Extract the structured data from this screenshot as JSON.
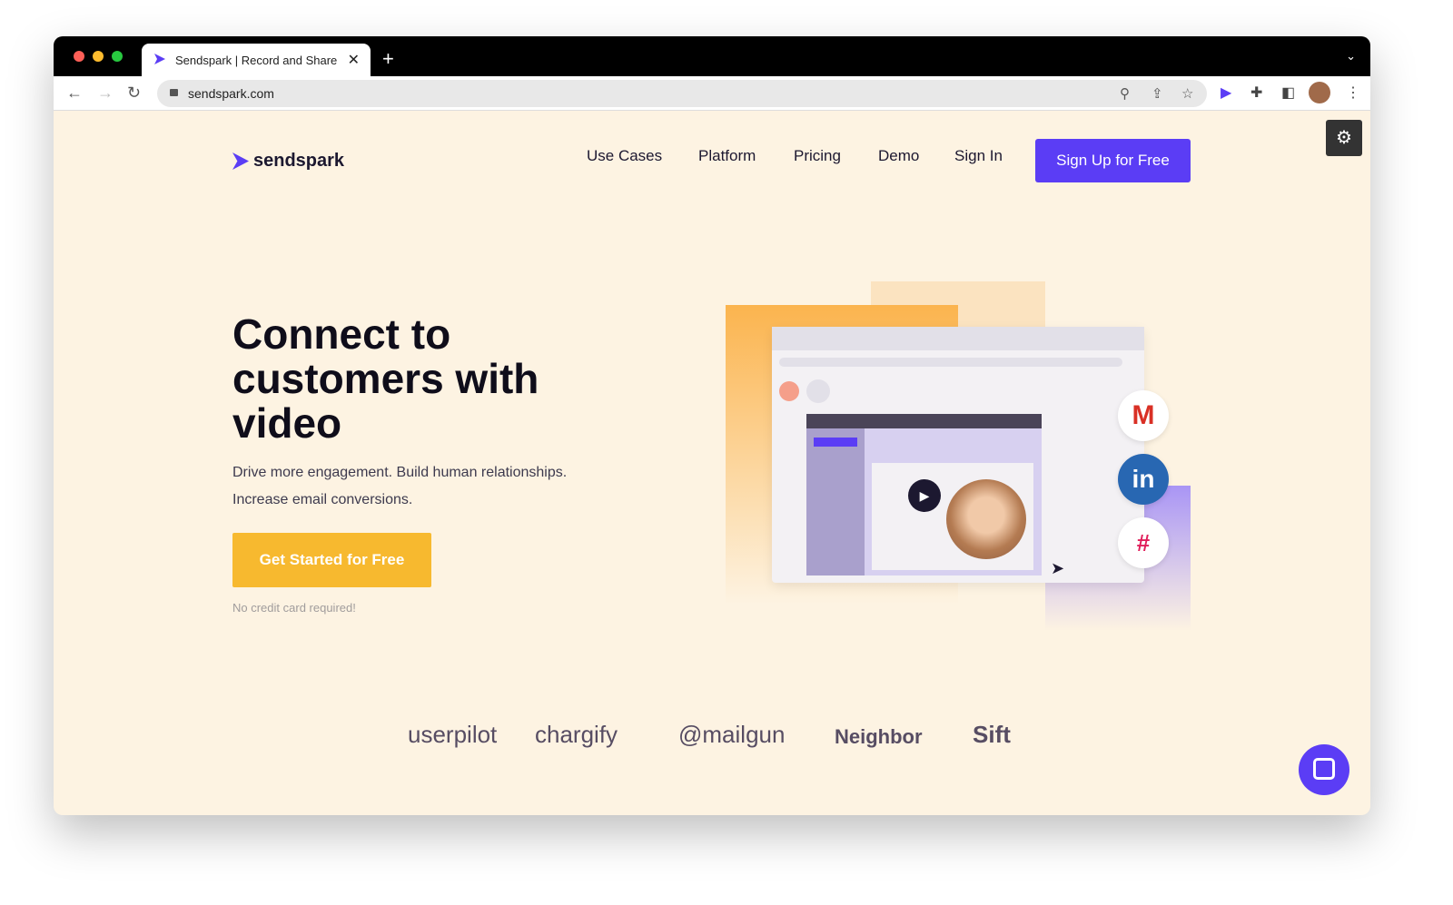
{
  "browser": {
    "tab_title": "Sendspark | Record and Share",
    "url": "sendspark.com",
    "new_tab": "+",
    "close": "✕"
  },
  "site": {
    "logo": "sendspark",
    "nav": [
      "Use Cases",
      "Platform",
      "Pricing",
      "Demo",
      "Sign In"
    ],
    "signup": "Sign Up for Free",
    "hero": {
      "title": "Connect to customers with video",
      "subtitle_1": "Drive more engagement. Build human relationships.",
      "subtitle_2": "Increase email conversions.",
      "cta": "Get Started for Free",
      "note": "No credit card required!"
    },
    "logos": [
      "userpilot",
      "chargify",
      "@mailgun",
      "Neighbor",
      "Sift"
    ]
  },
  "colors": {
    "brand": "#5b3df5",
    "cta": "#f7b92f",
    "background": "#fdf3e2"
  }
}
